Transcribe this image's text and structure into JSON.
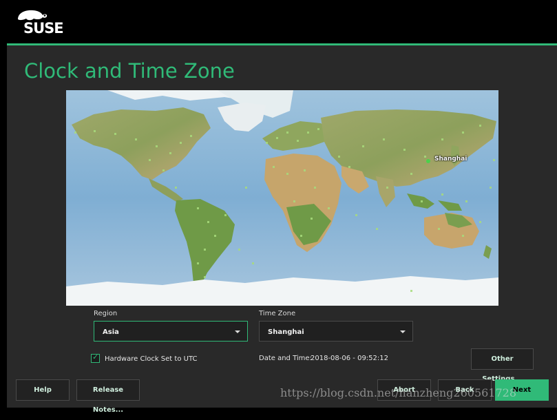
{
  "brand": {
    "logo_text": "SUSE"
  },
  "page": {
    "title": "Clock and Time Zone"
  },
  "map": {
    "selected_city": "Shanghai"
  },
  "region": {
    "label": "Region",
    "value": "Asia"
  },
  "timezone": {
    "label": "Time Zone",
    "value": "Shanghai"
  },
  "hardware_clock": {
    "label": "Hardware Clock Set to UTC",
    "checked": true
  },
  "datetime": {
    "label": "Date and Time:",
    "value": "2018-08-06 - 09:52:12"
  },
  "buttons": {
    "other_settings": "Other Settings...",
    "help": "Help",
    "release_notes": "Release Notes...",
    "abort": "Abort",
    "back": "Back",
    "next": "Next"
  },
  "watermark": "https://blog.csdn.net/hanzheng260561728",
  "colors": {
    "accent": "#30ba78",
    "background": "#292929",
    "topbar": "#000000"
  }
}
